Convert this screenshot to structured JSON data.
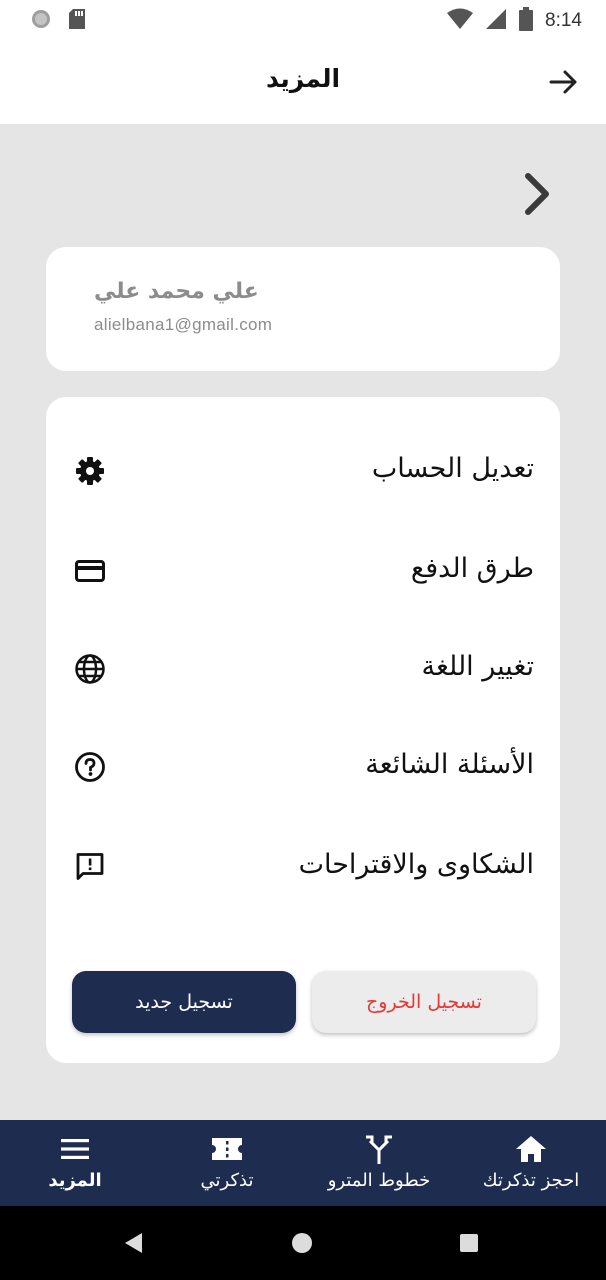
{
  "status_bar": {
    "time": "8:14"
  },
  "header": {
    "title": "المزيد"
  },
  "profile": {
    "name": "علي محمد علي",
    "email": "alielbana1@gmail.com"
  },
  "menu": {
    "items": [
      {
        "label": "تعديل الحساب",
        "icon": "gear-icon"
      },
      {
        "label": "طرق الدفع",
        "icon": "credit-card-icon"
      },
      {
        "label": "تغيير اللغة",
        "icon": "globe-icon"
      },
      {
        "label": "الأسئلة الشائعة",
        "icon": "help-icon"
      },
      {
        "label": "الشكاوى والاقتراحات",
        "icon": "feedback-icon"
      }
    ],
    "logout_label": "تسجيل الخروج",
    "register_label": "تسجيل جديد"
  },
  "bottom_nav": {
    "items": [
      {
        "label": "احجز تذكرتك",
        "icon": "home-icon"
      },
      {
        "label": "خطوط المترو",
        "icon": "fork-icon"
      },
      {
        "label": "تذكرتي",
        "icon": "ticket-icon"
      },
      {
        "label": "المزيد",
        "icon": "menu-icon",
        "active": true
      }
    ]
  },
  "colors": {
    "navy": "#1e2d4f",
    "danger": "#e53935",
    "background": "#e5e5e5"
  }
}
